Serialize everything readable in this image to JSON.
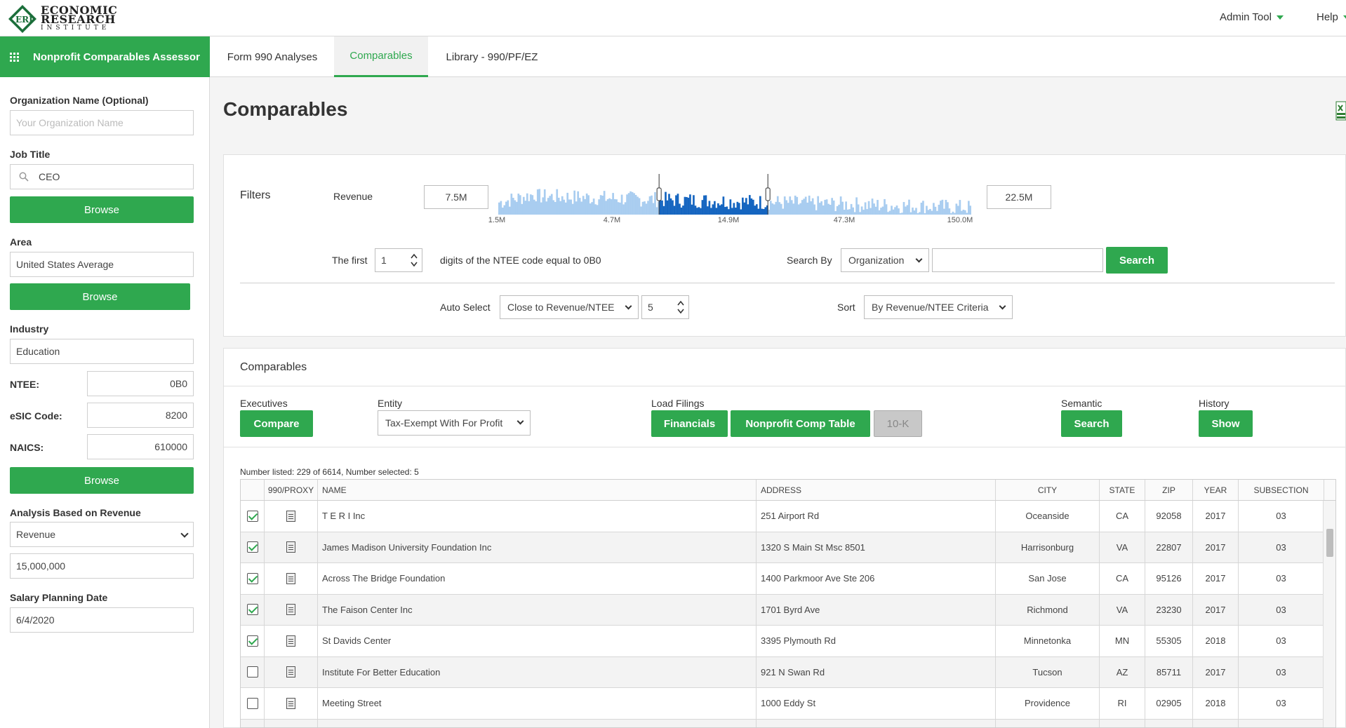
{
  "header": {
    "logo": {
      "line1": "ECONOMIC",
      "line2": "RESEARCH",
      "line3": "INSTITUTE",
      "mark": "ERI"
    },
    "admin_tool": "Admin Tool",
    "help": "Help"
  },
  "nav": {
    "app_title": "Nonprofit Comparables Assessor",
    "tabs": [
      {
        "label": "Form 990 Analyses"
      },
      {
        "label": "Comparables"
      },
      {
        "label": "Library - 990/PF/EZ"
      }
    ],
    "active_tab": "Comparables"
  },
  "sidebar": {
    "org_name_label": "Organization Name (Optional)",
    "org_name_placeholder": "Your Organization Name",
    "job_title_label": "Job Title",
    "job_title_value": "CEO",
    "browse_label": "Browse",
    "area_label": "Area",
    "area_value": "United States Average",
    "industry_label": "Industry",
    "industry_value": "Education",
    "ntee_label": "NTEE:",
    "ntee_value": "0B0",
    "esic_label": "eSIC Code:",
    "esic_value": "8200",
    "naics_label": "NAICS:",
    "naics_value": "610000",
    "analysis_label": "Analysis Based on Revenue",
    "analysis_select": "Revenue",
    "revenue_value": "15,000,000",
    "salary_date_label": "Salary Planning Date",
    "salary_date_value": "6/4/2020"
  },
  "main": {
    "title": "Comparables",
    "filters": {
      "title": "Filters",
      "revenue_label": "Revenue",
      "revenue_min": "7.5M",
      "revenue_max": "22.5M",
      "tick_labels": [
        "1.5M",
        "4.7M",
        "14.9M",
        "47.3M",
        "150.0M"
      ],
      "selected_range_fraction": [
        0.34,
        0.57
      ],
      "the_first_label": "The first",
      "the_first_value": "1",
      "ntee_text": "digits of the NTEE code equal to 0B0",
      "search_by_label": "Search By",
      "search_by_value": "Organization",
      "search_button": "Search",
      "auto_select_label": "Auto Select",
      "auto_select_value": "Close to Revenue/NTEE",
      "auto_select_count": "5",
      "sort_label": "Sort",
      "sort_value": "By Revenue/NTEE Criteria"
    },
    "comparables": {
      "title": "Comparables",
      "executives_label": "Executives",
      "compare_button": "Compare",
      "entity_label": "Entity",
      "entity_value": "Tax-Exempt With For Profit",
      "load_filings_label": "Load Filings",
      "financials_button": "Financials",
      "comp_table_button": "Nonprofit Comp Table",
      "tenk_button": "10-K",
      "semantic_label": "Semantic",
      "semantic_button": "Search",
      "history_label": "History",
      "history_button": "Show",
      "count_text": "Number listed: 229 of 6614, Number selected: 5"
    },
    "table": {
      "columns": [
        "",
        "990/PROXY",
        "NAME",
        "ADDRESS",
        "CITY",
        "STATE",
        "ZIP",
        "YEAR",
        "SUBSECTION"
      ],
      "rows": [
        {
          "checked": true,
          "name": "T E R I Inc",
          "address": "251 Airport Rd",
          "city": "Oceanside",
          "state": "CA",
          "zip": "92058",
          "year": "2017",
          "sub": "03"
        },
        {
          "checked": true,
          "name": "James Madison University Foundation Inc",
          "address": "1320 S Main St Msc 8501",
          "city": "Harrisonburg",
          "state": "VA",
          "zip": "22807",
          "year": "2017",
          "sub": "03"
        },
        {
          "checked": true,
          "name": "Across The Bridge Foundation",
          "address": "1400 Parkmoor Ave Ste 206",
          "city": "San Jose",
          "state": "CA",
          "zip": "95126",
          "year": "2017",
          "sub": "03"
        },
        {
          "checked": true,
          "name": "The Faison Center Inc",
          "address": "1701 Byrd Ave",
          "city": "Richmond",
          "state": "VA",
          "zip": "23230",
          "year": "2017",
          "sub": "03"
        },
        {
          "checked": true,
          "name": "St Davids Center",
          "address": "3395 Plymouth Rd",
          "city": "Minnetonka",
          "state": "MN",
          "zip": "55305",
          "year": "2018",
          "sub": "03"
        },
        {
          "checked": false,
          "name": "Institute For Better Education",
          "address": "921 N Swan Rd",
          "city": "Tucson",
          "state": "AZ",
          "zip": "85711",
          "year": "2017",
          "sub": "03"
        },
        {
          "checked": false,
          "name": "Meeting Street",
          "address": "1000 Eddy St",
          "city": "Providence",
          "state": "RI",
          "zip": "02905",
          "year": "2018",
          "sub": "03"
        },
        {
          "checked": false,
          "name": "",
          "address": "",
          "city": "",
          "state": "",
          "zip": "",
          "year": "",
          "sub": ""
        }
      ]
    }
  },
  "colors": {
    "accent": "#2fa84f",
    "histogram_light": "#a9cdf0",
    "histogram_dark": "#1565c0"
  },
  "icons": [
    "eri-logo-icon",
    "grid-icon",
    "search-icon",
    "excel-icon",
    "checkbox-icon",
    "document-icon",
    "chevron-down-icon",
    "spinner-icon"
  ]
}
